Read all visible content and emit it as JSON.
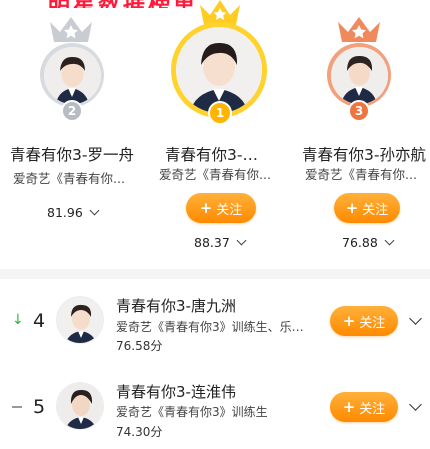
{
  "banner": {
    "text": "明星数据榜单"
  },
  "podium": [
    {
      "rank": "2",
      "name": "青春有你3-罗一舟",
      "subtitle": "爱奇艺《青春有你...",
      "score": "81.96"
    },
    {
      "rank": "1",
      "name": "青春有你3-…",
      "subtitle": "爱奇艺《青春有你...",
      "score": "88.37",
      "follow": "关注"
    },
    {
      "rank": "3",
      "name": "青春有你3-孙亦航",
      "subtitle": "爱奇艺《青春有你...",
      "score": "76.88",
      "follow": "关注"
    }
  ],
  "list": [
    {
      "trend": "up",
      "trend_icon": "↓",
      "rank": "4",
      "name": "青春有你3-唐九洲",
      "subtitle": "爱奇艺《青春有你3》训练生、乐…",
      "score": "76.58分",
      "follow": "关注"
    },
    {
      "trend": "flat",
      "rank": "5",
      "name": "青春有你3-连淮伟",
      "subtitle": "爱奇艺《青春有你3》训练生",
      "score": "74.30分",
      "follow": "关注"
    }
  ],
  "colors": {
    "gold": "#ffcc22",
    "silver": "#c9cdd3",
    "bronze": "#f08a5d",
    "accent": "#ff8a00",
    "banner": "#ff1a3a"
  }
}
